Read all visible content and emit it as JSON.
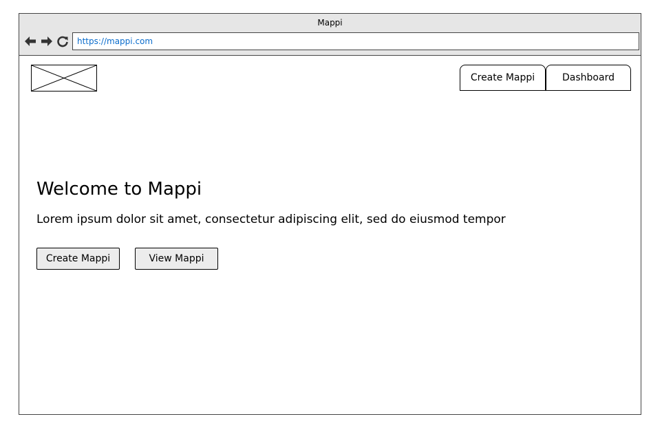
{
  "window": {
    "title": "Mappi"
  },
  "browser": {
    "url": "https://mappi.com",
    "icons": [
      "back-arrow-icon",
      "forward-arrow-icon",
      "reload-icon"
    ]
  },
  "header": {
    "logo": "image-placeholder",
    "tabs": [
      {
        "label": "Create Mappi"
      },
      {
        "label": "Dashboard"
      }
    ]
  },
  "hero": {
    "title": "Welcome to Mappi",
    "text": "Lorem ipsum dolor sit amet, consectetur adipiscing elit, sed do eiusmod tempor",
    "buttons": [
      {
        "label": "Create Mappi"
      },
      {
        "label": "View Mappi"
      }
    ]
  },
  "colors": {
    "chrome_bg": "#e6e6e6",
    "url_text": "#0a6ccc",
    "button_bg": "#ececec",
    "border": "#000000"
  }
}
